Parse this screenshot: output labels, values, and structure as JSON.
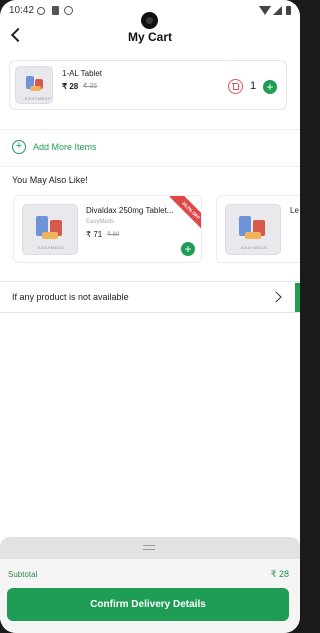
{
  "status_bar": {
    "time": "10:42"
  },
  "header": {
    "title": "My Cart"
  },
  "cart": {
    "items": [
      {
        "name": "1-AL Tablet",
        "price": "₹ 28",
        "mrp": "₹ 35",
        "quantity": "1"
      }
    ],
    "add_more_label": "Add More Items"
  },
  "suggestions": {
    "heading": "You May Also Like!",
    "items": [
      {
        "name": "Divaldax 250mg Tablet...",
        "brand": "EasyMeds",
        "price": "₹ 71",
        "mrp": "₹ 89",
        "discount_badge": "20.2% OFF"
      },
      {
        "name": "Le"
      }
    ]
  },
  "unavailable": {
    "label": "If any product is not available"
  },
  "footer": {
    "subtotal_label": "Subtotal",
    "subtotal_value": "₹ 28",
    "confirm_label": "Confirm Delivery Details"
  },
  "thumbnail_caption": "EASYMEDS",
  "colors": {
    "accent_green": "#1f9d55",
    "delete_red": "#e25555",
    "discount_red": "#e04848"
  },
  "icons": [
    "back-arrow-icon",
    "delete-icon",
    "plus-icon",
    "add-circle-icon",
    "chevron-right-icon",
    "drag-handle-icon"
  ]
}
